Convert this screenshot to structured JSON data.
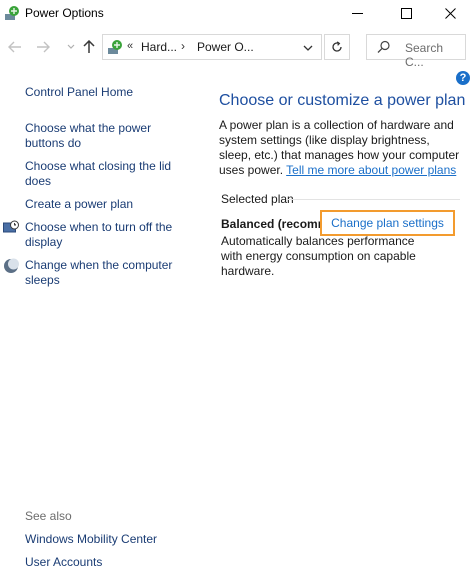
{
  "window": {
    "title": "Power Options",
    "buttons": {
      "minimize": "minimize-icon",
      "maximize": "maximize-icon",
      "close": "close-icon"
    }
  },
  "nav": {
    "back_icon": "arrow-left-icon",
    "forward_icon": "arrow-right-icon",
    "recent_icon": "chevron-down-icon",
    "up_icon": "arrow-up-icon"
  },
  "address": {
    "overflow_chevron": "«",
    "segments": [
      "Hard...",
      "Power O..."
    ],
    "separator": "›"
  },
  "search": {
    "placeholder": "Search C..."
  },
  "help": {
    "label": "?"
  },
  "left_pane": {
    "home": "Control Panel Home",
    "links": [
      "Choose what the power buttons do",
      "Choose what closing the lid does",
      "Create a power plan",
      "Choose when to turn off the display",
      "Change when the computer sleeps"
    ],
    "see_also": "See also",
    "see_also_links": [
      "Windows Mobility Center",
      "User Accounts"
    ]
  },
  "main": {
    "heading": "Choose or customize a power plan",
    "description": "A power plan is a collection of hardware and system settings (like display brightness, sleep, etc.) that manages how your computer uses power.",
    "description_link": "Tell me more about power plans",
    "selected_plan_label": "Selected plan",
    "plan_name": "Balanced (recommended)",
    "change_plan_button": "Change plan settings",
    "plan_description": "Automatically balances performance with energy consumption on capable hardware."
  },
  "colors": {
    "link": "#1a3c74",
    "heading": "#1e4fa0",
    "accent_link": "#1a6fc9",
    "highlight_border": "#f39b2e"
  }
}
